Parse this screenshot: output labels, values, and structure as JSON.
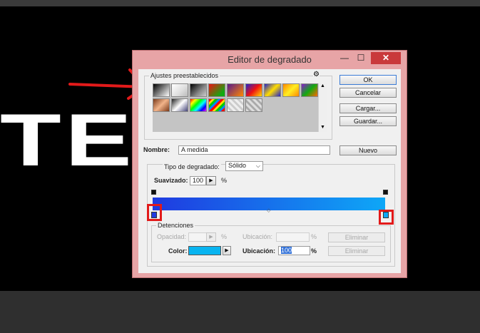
{
  "dialog": {
    "title": "Editor de degradado",
    "controls": {
      "minimize": "—",
      "maximize": "☐",
      "close": "✕"
    }
  },
  "presets": {
    "legend": "Ajustes preestablecidos",
    "menu_icon": "gear-icon",
    "swatches_row1": [
      "black-white",
      "white-transparent",
      "black-transparent",
      "red-green",
      "violet-orange",
      "blue-red-yellow",
      "blue-yellow-blue",
      "orange-yellow-orange",
      "violet-green-orange"
    ],
    "swatches_row2": [
      "copper",
      "chrome",
      "spectrum",
      "rainbow-stripes",
      "transparent-rainbow",
      "transparent-stripes"
    ]
  },
  "buttons": {
    "ok": "OK",
    "cancel": "Cancelar",
    "load": "Cargar...",
    "save": "Guardar...",
    "new": "Nuevo"
  },
  "name": {
    "label": "Nombre:",
    "value": "A medida"
  },
  "gradient_type": {
    "label": "Tipo de degradado:",
    "value": "Sólido"
  },
  "smoothness": {
    "label": "Suavizado:",
    "value": "100",
    "unit": "%"
  },
  "gradient": {
    "start_color": "#1f3ae0",
    "end_color": "#0ea7f7",
    "midpoint": 0.5
  },
  "stops": {
    "legend": "Detenciones",
    "opacity": {
      "label": "Opacidad:",
      "value": "",
      "unit": "%",
      "location_label": "Ubicación:",
      "location_value": "",
      "location_unit": "%",
      "delete": "Eliminar"
    },
    "color": {
      "label": "Color:",
      "value": "#08b4f0",
      "location_label": "Ubicación:",
      "location_value": "100",
      "location_unit": "%",
      "delete": "Eliminar"
    }
  },
  "colors": {
    "title_bar": "#e7a4a6",
    "close": "#c9393b",
    "annotation": "#e21a1a"
  }
}
